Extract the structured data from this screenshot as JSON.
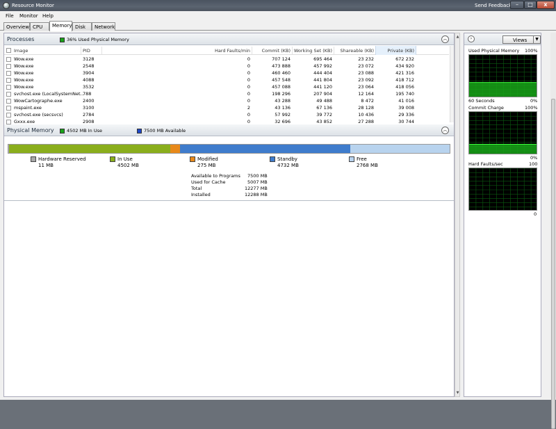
{
  "window": {
    "title": "Resource Monitor",
    "feedback": "Send Feedback",
    "min": "–",
    "max": "□",
    "close": "x"
  },
  "menu": [
    "File",
    "Monitor",
    "Help"
  ],
  "tabs": [
    "Overview",
    "CPU",
    "Memory",
    "Disk",
    "Network"
  ],
  "active_tab": "Memory",
  "processes": {
    "title": "Processes",
    "status": "36% Used Physical Memory",
    "status_color": "#1aa31a",
    "columns": [
      "Image",
      "PID",
      "Hard Faults/min",
      "Commit (KB)",
      "Working Set (KB)",
      "Shareable (KB)",
      "Private (KB)"
    ],
    "rows": [
      [
        "Wow.exe",
        "3128",
        "0",
        "707 124",
        "695 464",
        "23 232",
        "672 232"
      ],
      [
        "Wow.exe",
        "2548",
        "0",
        "473 888",
        "457 992",
        "23 072",
        "434 920"
      ],
      [
        "Wow.exe",
        "3904",
        "0",
        "460 460",
        "444 404",
        "23 088",
        "421 316"
      ],
      [
        "Wow.exe",
        "4088",
        "0",
        "457 548",
        "441 804",
        "23 092",
        "418 712"
      ],
      [
        "Wow.exe",
        "3532",
        "0",
        "457 088",
        "441 120",
        "23 064",
        "418 056"
      ],
      [
        "svchost.exe (LocalSystemNet...",
        "788",
        "0",
        "198 296",
        "207 904",
        "12 164",
        "195 740"
      ],
      [
        "WowCartographe.exe",
        "2400",
        "0",
        "43 288",
        "49 488",
        "8 472",
        "41 016"
      ],
      [
        "mspaint.exe",
        "3100",
        "2",
        "43 136",
        "67 136",
        "28 128",
        "39 008"
      ],
      [
        "svchost.exe (secsvcs)",
        "2784",
        "0",
        "57 992",
        "39 772",
        "10 436",
        "29 336"
      ],
      [
        "Gxxx.exe",
        "2908",
        "0",
        "32 696",
        "43 852",
        "27 288",
        "30 744"
      ]
    ]
  },
  "physical": {
    "title": "Physical Memory",
    "in_use_label": "4502 MB In Use",
    "available_label": "7500 MB Available",
    "in_use_color": "#1aa31a",
    "available_color": "#1f47c8",
    "segments": [
      {
        "name": "Hardware Reserved",
        "value": "11 MB",
        "mb": 11,
        "color": "#a9a9a9"
      },
      {
        "name": "In Use",
        "value": "4502 MB",
        "mb": 4502,
        "color": "#8aae1c"
      },
      {
        "name": "Modified",
        "value": "275 MB",
        "mb": 275,
        "color": "#e8891a"
      },
      {
        "name": "Standby",
        "value": "4732 MB",
        "mb": 4732,
        "color": "#3f7ccc"
      },
      {
        "name": "Free",
        "value": "2768 MB",
        "mb": 2768,
        "color": "#b8d3ee"
      }
    ],
    "stats": [
      {
        "label": "Available to Programs",
        "value": "7500 MB"
      },
      {
        "label": "Used for Cache",
        "value": "5007 MB"
      },
      {
        "label": "Total",
        "value": "12277 MB"
      },
      {
        "label": "Installed",
        "value": "12288 MB"
      }
    ]
  },
  "graphs": {
    "views_label": "Views",
    "items": [
      {
        "title": "Used Physical Memory",
        "max": "100%",
        "foot_left": "60 Seconds",
        "foot_right": "0%",
        "level": 0.36
      },
      {
        "title": "Commit Charge",
        "max": "100%",
        "foot_left": "",
        "foot_right": "0%",
        "level": 0.25
      },
      {
        "title": "Hard Faults/sec",
        "max": "100",
        "foot_left": "",
        "foot_right": "0",
        "level": 0.01
      }
    ]
  }
}
